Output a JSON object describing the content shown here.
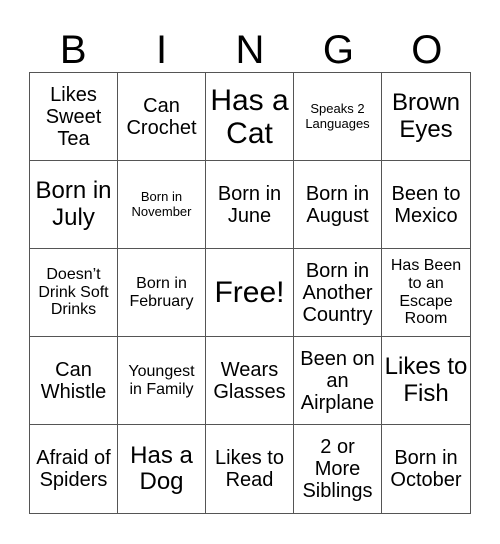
{
  "header": [
    "B",
    "I",
    "N",
    "G",
    "O"
  ],
  "cells": [
    {
      "text": "Likes Sweet Tea",
      "size": "md"
    },
    {
      "text": "Can Crochet",
      "size": "md"
    },
    {
      "text": "Has a Cat",
      "size": "xl"
    },
    {
      "text": "Speaks 2 Languages",
      "size": "xs"
    },
    {
      "text": "Brown Eyes",
      "size": "lg"
    },
    {
      "text": "Born in July",
      "size": "lg"
    },
    {
      "text": "Born in November",
      "size": "xs"
    },
    {
      "text": "Born in June",
      "size": "md"
    },
    {
      "text": "Born in August",
      "size": "md"
    },
    {
      "text": "Been to Mexico",
      "size": "md"
    },
    {
      "text": "Doesn’t Drink Soft Drinks",
      "size": "sm"
    },
    {
      "text": "Born in February",
      "size": "sm"
    },
    {
      "text": "Free!",
      "size": "xl"
    },
    {
      "text": "Born in Another Country",
      "size": "md"
    },
    {
      "text": "Has Been to an Escape Room",
      "size": "sm"
    },
    {
      "text": "Can Whistle",
      "size": "md"
    },
    {
      "text": "Youngest in Family",
      "size": "sm"
    },
    {
      "text": "Wears Glasses",
      "size": "md"
    },
    {
      "text": "Been on an Airplane",
      "size": "md"
    },
    {
      "text": "Likes to Fish",
      "size": "lg"
    },
    {
      "text": "Afraid of Spiders",
      "size": "md"
    },
    {
      "text": "Has a Dog",
      "size": "lg"
    },
    {
      "text": "Likes to Read",
      "size": "md"
    },
    {
      "text": "2 or More Siblings",
      "size": "md"
    },
    {
      "text": "Born in October",
      "size": "md"
    }
  ]
}
